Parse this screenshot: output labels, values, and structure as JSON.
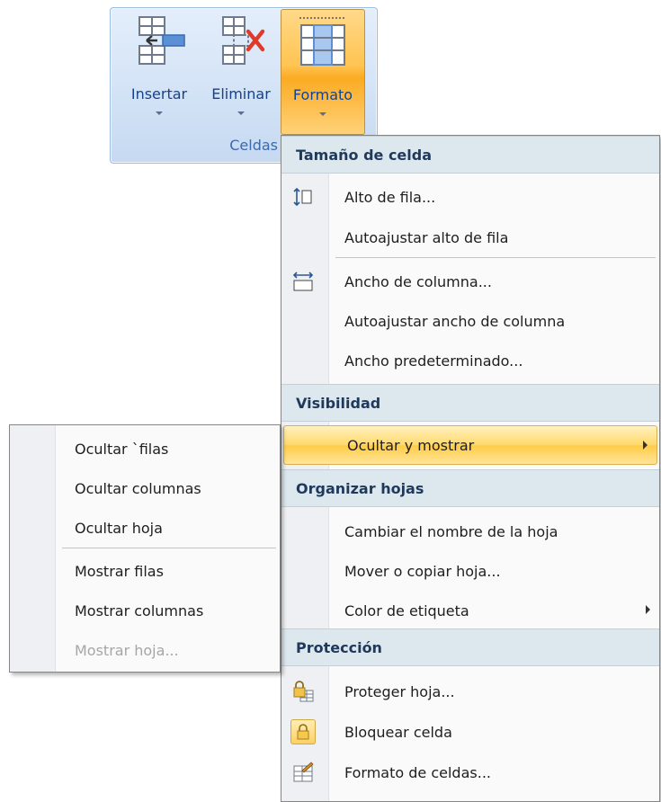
{
  "ribbon": {
    "group_label": "Celdas",
    "buttons": {
      "insertar": "Insertar",
      "eliminar": "Eliminar",
      "formato": "Formato"
    }
  },
  "format_menu": {
    "sections": {
      "cell_size": "Tamaño de celda",
      "visibility": "Visibilidad",
      "organize": "Organizar hojas",
      "protection": "Protección"
    },
    "items": {
      "row_height": "Alto de fila...",
      "autofit_row_height": "Autoajustar alto de fila",
      "column_width": "Ancho de columna...",
      "autofit_column_width": "Autoajustar ancho de columna",
      "default_width": "Ancho predeterminado...",
      "hide_show": "Ocultar y mostrar",
      "rename_sheet": "Cambiar el nombre de la hoja",
      "move_copy_sheet": "Mover o copiar hoja...",
      "tab_color": "Color de etiqueta",
      "protect_sheet": "Proteger hoja...",
      "lock_cell": "Bloquear celda",
      "format_cells": "Formato de celdas..."
    }
  },
  "hide_show_submenu": {
    "items": {
      "hide_rows": "Ocultar `filas",
      "hide_columns": "Ocultar columnas",
      "hide_sheet": "Ocultar hoja",
      "show_rows": "Mostrar filas",
      "show_columns": "Mostrar columnas",
      "show_sheet": "Mostrar hoja..."
    },
    "disabled": [
      "show_sheet"
    ]
  },
  "colors": {
    "ribbon_text": "#15428b",
    "highlight": "#ffd96b",
    "section_header_bg": "#dde7ee",
    "disabled_text": "#a6a6a6"
  }
}
